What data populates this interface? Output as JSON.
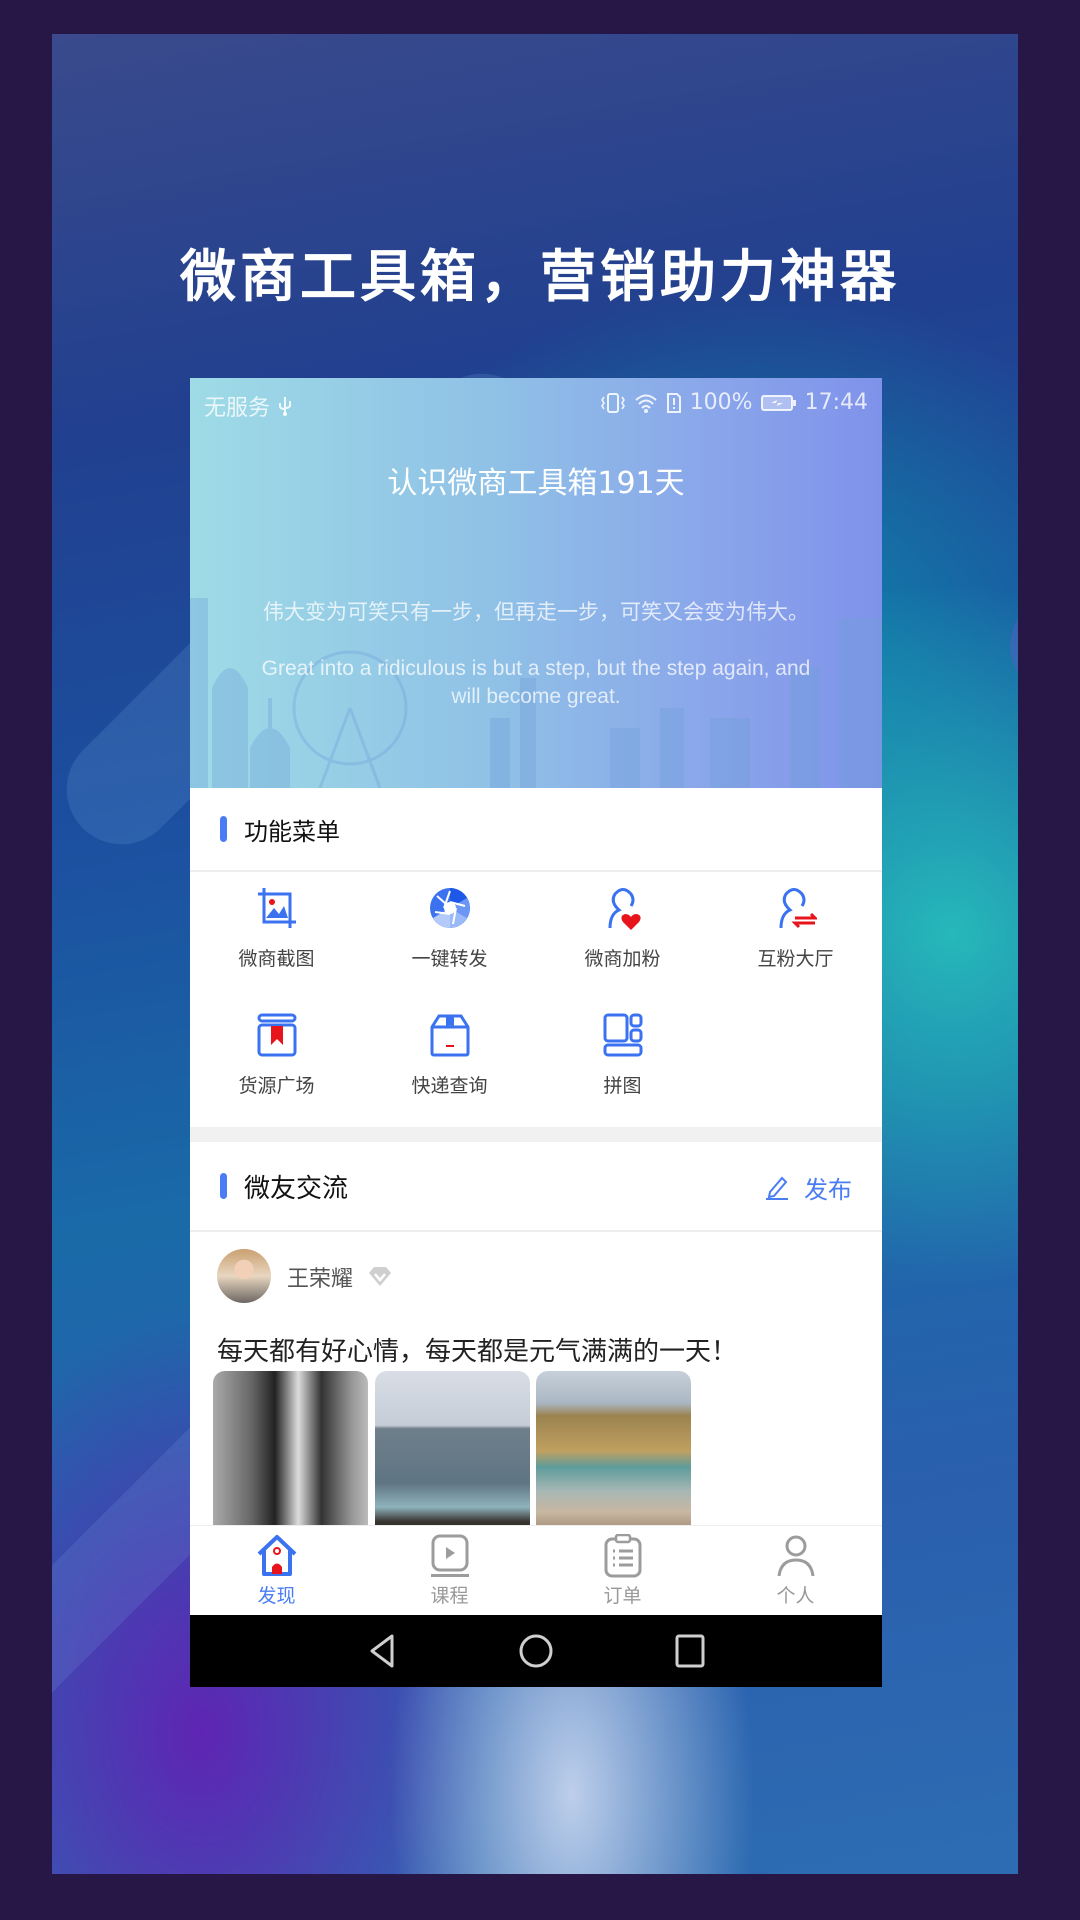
{
  "poster": {
    "headline": "微商工具箱，营销助力神器"
  },
  "status_bar": {
    "carrier": "无服务",
    "usb_icon": "usb-icon",
    "vibrate_icon": "vibrate-icon",
    "wifi_icon": "wifi-icon",
    "sim_icon": "sim-alert-icon",
    "battery_percent": "100%",
    "battery_icon": "battery-charging-icon",
    "time": "17:44"
  },
  "hero": {
    "title": "认识微商工具箱191天",
    "quote_cn": "伟大变为可笑只有一步，但再走一步，可笑又会变为伟大。",
    "quote_en": "Great into a ridiculous is but a step, but the step again, and will become great."
  },
  "function_menu": {
    "title": "功能菜单",
    "items": [
      {
        "label": "微商截图",
        "icon": "screenshot-crop-icon"
      },
      {
        "label": "一键转发",
        "icon": "shutter-icon"
      },
      {
        "label": "微商加粉",
        "icon": "user-heart-icon"
      },
      {
        "label": "互粉大厅",
        "icon": "user-exchange-icon"
      },
      {
        "label": "货源广场",
        "icon": "bookmark-box-icon"
      },
      {
        "label": "快递查询",
        "icon": "package-icon"
      },
      {
        "label": "拼图",
        "icon": "collage-icon"
      }
    ]
  },
  "community": {
    "title": "微友交流",
    "publish_label": "发布",
    "publish_icon": "pencil-icon",
    "post": {
      "author": "王荣耀",
      "badge_icon": "diamond-icon",
      "text": "每天都有好心情，每天都是元气满满的一天！",
      "images": [
        "woman-sunglasses-photo",
        "seascape-photo",
        "coastal-cliff-photo"
      ]
    }
  },
  "tabbar": {
    "tabs": [
      {
        "label": "发现",
        "icon": "home-icon",
        "active": true
      },
      {
        "label": "课程",
        "icon": "play-video-icon",
        "active": false
      },
      {
        "label": "订单",
        "icon": "clipboard-list-icon",
        "active": false
      },
      {
        "label": "个人",
        "icon": "person-icon",
        "active": false
      }
    ]
  },
  "navbar": {
    "buttons": [
      "back-icon",
      "home-circle-icon",
      "recents-icon"
    ]
  },
  "colors": {
    "accent": "#4a7cf3",
    "accent_red": "#e8141b",
    "frame": "#271746",
    "inactive": "#999999"
  }
}
